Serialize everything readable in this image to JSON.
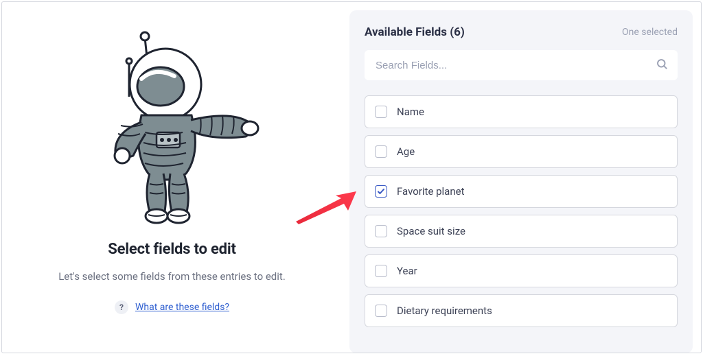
{
  "left": {
    "title": "Select fields to edit",
    "subtitle": "Let's select some fields from these entries to edit.",
    "help_label": "What are these fields?",
    "help_badge": "?"
  },
  "panel": {
    "title_label": "Available Fields",
    "count": 6,
    "status": "One selected",
    "search_placeholder": "Search Fields..."
  },
  "fields": [
    {
      "label": "Name",
      "checked": false
    },
    {
      "label": "Age",
      "checked": false
    },
    {
      "label": "Favorite planet",
      "checked": true
    },
    {
      "label": "Space suit size",
      "checked": false
    },
    {
      "label": "Year",
      "checked": false
    },
    {
      "label": "Dietary requirements",
      "checked": false
    }
  ]
}
